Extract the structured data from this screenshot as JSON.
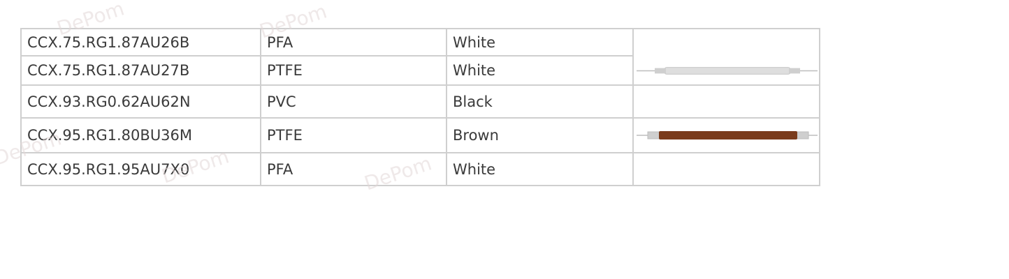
{
  "table": {
    "rows": [
      {
        "part_number": "CCX.75.RG1.87AU26B",
        "material": "PFA",
        "color": "White"
      },
      {
        "part_number": "CCX.75.RG1.87AU27B",
        "material": "PTFE",
        "color": "White"
      },
      {
        "part_number": "CCX.93.RG0.62AU62N",
        "material": "PVC",
        "color": "Black"
      },
      {
        "part_number": "CCX.95.RG1.80BU36M",
        "material": "PTFE",
        "color": "Brown"
      },
      {
        "part_number": "CCX.95.RG1.95AU7X0",
        "material": "PFA",
        "color": "White"
      }
    ]
  },
  "cable_images": [
    {
      "rows": "1-2",
      "body_color": "#dedede",
      "end_color": "#c9c9c9"
    },
    {
      "rows": "4",
      "body_color": "#7a3b1c",
      "end_color": "#c9c9c9"
    }
  ],
  "watermark": {
    "text": "DePom",
    "color": "#e1d7d7"
  }
}
